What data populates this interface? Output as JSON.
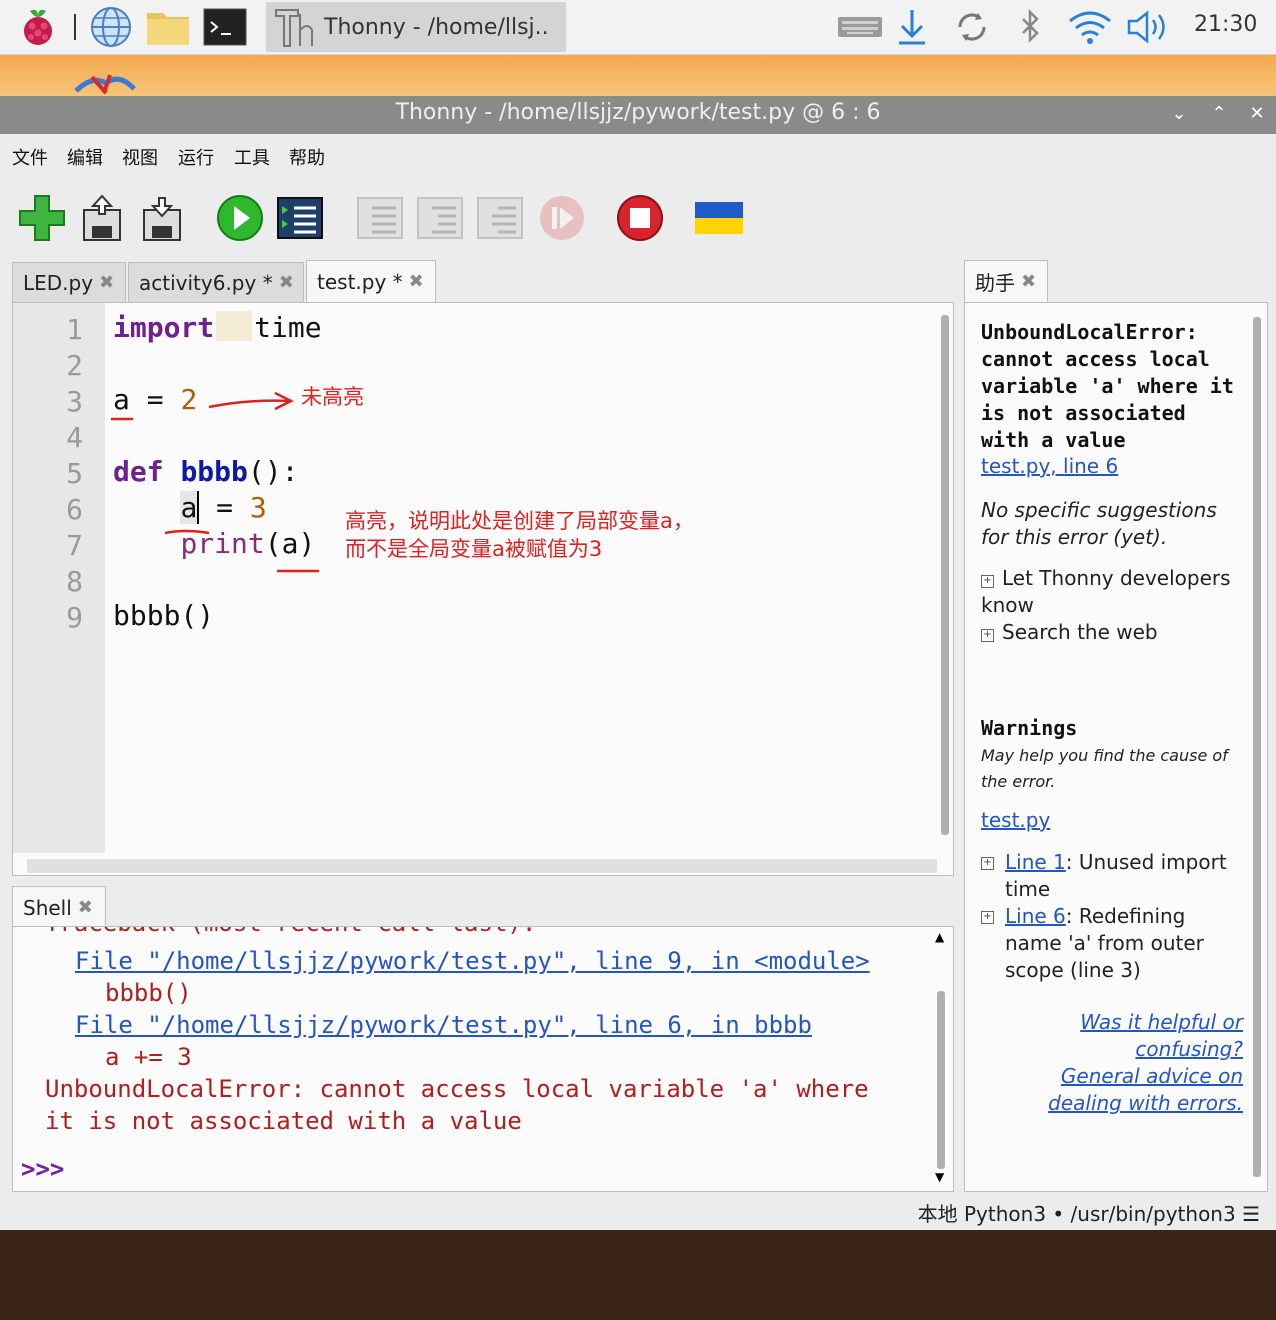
{
  "taskbar": {
    "task_label": "Thonny  -  /home/llsj..",
    "clock": "21:30"
  },
  "window": {
    "title": "Thonny  -  /home/llsjjz/pywork/test.py  @  6 : 6"
  },
  "menu": [
    "文件",
    "编辑",
    "视图",
    "运行",
    "工具",
    "帮助"
  ],
  "toolbar": {
    "icons": [
      "new-file-icon",
      "open-file-icon",
      "save-file-icon",
      "run-icon",
      "debug-icon",
      "step-over-icon",
      "step-into-icon",
      "step-out-icon",
      "resume-icon",
      "stop-icon",
      "ukraine-flag-icon"
    ]
  },
  "editor": {
    "tabs": [
      {
        "label": "LED.py",
        "close": "✖"
      },
      {
        "label": "activity6.py *",
        "close": "✖"
      },
      {
        "label": "test.py *",
        "close": "✖"
      }
    ],
    "line_numbers": [
      "1",
      "2",
      "3",
      "4",
      "5",
      "6",
      "7",
      "8",
      "9"
    ],
    "code": {
      "l1_kw": "import",
      "l1_rest": "time",
      "l3_var": "a",
      "l3_op": " = ",
      "l3_num": "2",
      "l5_kw": "def",
      "l5_fn": "bbbb",
      "l5_rest": "():",
      "l6_var": "a",
      "l6_op": " = ",
      "l6_num": "3",
      "l7_fn": "print",
      "l7_rest": "(a)",
      "l9": "bbbb()"
    }
  },
  "annotations": {
    "not_highlighted": "未高亮",
    "highlighted_line1": "高亮，说明此处是创建了局部变量a，",
    "highlighted_line2": "而不是全局变量a被赋值为3"
  },
  "shell": {
    "tab_label": "Shell",
    "tab_close": "✖",
    "lines": {
      "traceback": "Traceback (most recent call last):",
      "file1": "File \"/home/llsjjz/pywork/test.py\", line 9, in <module>",
      "code1": "bbbb()",
      "file2": "File \"/home/llsjjz/pywork/test.py\", line 6, in bbbb",
      "code2": "a += 3",
      "err1": "UnboundLocalError: cannot access local variable 'a' where",
      "err2": "it is not associated with a value"
    },
    "prompt": ">>>"
  },
  "assistant": {
    "tab_label": "助手",
    "tab_close": "✖",
    "error_title": "UnboundLocalError: cannot access local variable 'a' where it is not associated with a value",
    "error_link": "test.py, line 6",
    "no_suggestions": "No specific suggestions for this error (yet).",
    "expanders": [
      "Let Thonny developers know",
      "Search the web"
    ],
    "warnings_heading": "Warnings",
    "warnings_sub": "May help you find the cause of the error.",
    "warnings_file_link": "test.py",
    "warnings": [
      {
        "link": "Line 1",
        "text": ": Unused import time"
      },
      {
        "link": "Line 6",
        "text": ": Redefining name 'a' from outer scope (line 3)"
      }
    ],
    "helpful_link": "Was it helpful or confusing?",
    "advice_link": "General advice on dealing with errors."
  },
  "statusbar": {
    "text": "本地 Python3  •  /usr/bin/python3  ☰"
  },
  "colors": {
    "keyword": "#6f1f8f",
    "function": "#0b1aa8",
    "number": "#b35c00",
    "error_text": "#b01e1e",
    "link": "#2455c4",
    "annotation": "#e02020"
  }
}
